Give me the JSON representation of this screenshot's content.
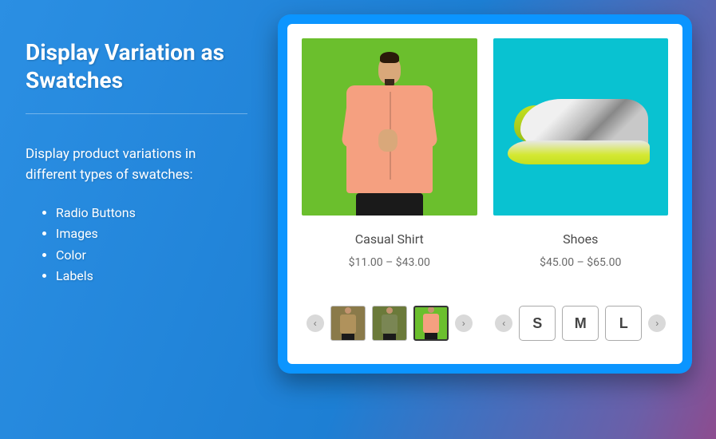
{
  "title": "Display Variation as Swatches",
  "description": "Display product variations in different types of swatches:",
  "bullets": [
    "Radio Buttons",
    "Images",
    "Color",
    "Labels"
  ],
  "products": [
    {
      "name": "Casual Shirt",
      "price": "$11.00 – $43.00"
    },
    {
      "name": "Shoes",
      "price": "$45.00 – $65.00"
    }
  ],
  "sizeLabels": [
    "S",
    "M",
    "L"
  ],
  "imageSwatches": [
    "tan",
    "olive",
    "salmon"
  ]
}
